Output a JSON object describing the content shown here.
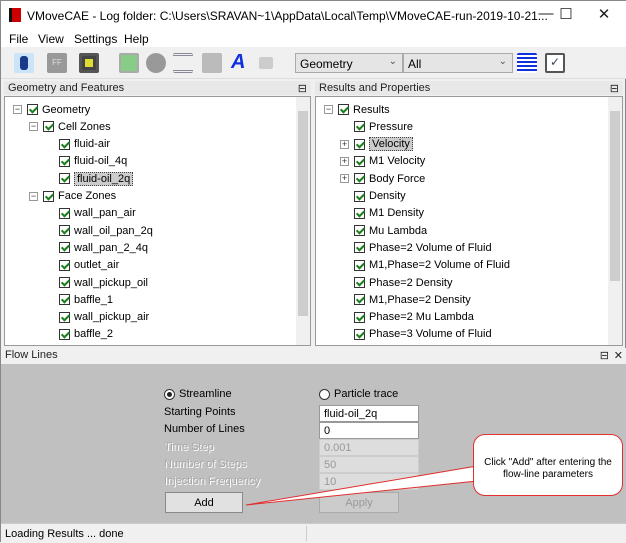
{
  "window": {
    "title": "VMoveCAE - Log folder: C:\\Users\\SRAVAN~1\\AppData\\Local\\Temp\\VMoveCAE-run-2019-10-21...",
    "minimize": "—",
    "maximize": "☐",
    "close": "✕"
  },
  "menu": [
    "File",
    "View",
    "Settings",
    "Help"
  ],
  "toolbar": {
    "icons": [
      "open-icon",
      "ff-icon",
      "save-icon",
      "cube-icon",
      "disc-icon",
      "streamlines-icon",
      "layers-add-icon",
      "text-icon",
      "stack-icon",
      "list-icon",
      "checkbox-icon"
    ],
    "text_glyph": "A",
    "ff_glyph": "FF",
    "dropdown1": "Geometry",
    "dropdown2": "All"
  },
  "left_panel": {
    "title": "Geometry and Features",
    "items": [
      {
        "label": "Geometry",
        "level": 0,
        "expand": "−"
      },
      {
        "label": "Cell Zones",
        "level": 1,
        "expand": "−"
      },
      {
        "label": "fluid-air",
        "level": 2
      },
      {
        "label": "fluid-oil_4q",
        "level": 2
      },
      {
        "label": "fluid-oil_2q",
        "level": 2,
        "selected": true
      },
      {
        "label": "Face Zones",
        "level": 1,
        "expand": "−"
      },
      {
        "label": "wall_pan_air",
        "level": 2
      },
      {
        "label": "wall_oil_pan_2q",
        "level": 2
      },
      {
        "label": "wall_pan_2_4q",
        "level": 2
      },
      {
        "label": "outlet_air",
        "level": 2
      },
      {
        "label": "wall_pickup_oil",
        "level": 2
      },
      {
        "label": "baffle_1",
        "level": 2
      },
      {
        "label": "wall_pickup_air",
        "level": 2
      },
      {
        "label": "baffle_2",
        "level": 2
      }
    ]
  },
  "right_panel": {
    "title": "Results and Properties",
    "items": [
      {
        "label": "Results",
        "level": 0,
        "expand": "−"
      },
      {
        "label": "Pressure",
        "level": 1
      },
      {
        "label": "Velocity",
        "level": 1,
        "expand": "+",
        "selected": true
      },
      {
        "label": "M1 Velocity",
        "level": 1,
        "expand": "+"
      },
      {
        "label": "Body Force",
        "level": 1,
        "expand": "+"
      },
      {
        "label": "Density",
        "level": 1
      },
      {
        "label": "M1 Density",
        "level": 1
      },
      {
        "label": "Mu Lambda",
        "level": 1
      },
      {
        "label": "Phase=2 Volume of Fluid",
        "level": 1
      },
      {
        "label": "M1,Phase=2 Volume of Fluid",
        "level": 1
      },
      {
        "label": "Phase=2 Density",
        "level": 1
      },
      {
        "label": "M1,Phase=2 Density",
        "level": 1
      },
      {
        "label": "Phase=2 Mu Lambda",
        "level": 1
      },
      {
        "label": "Phase=3 Volume of Fluid",
        "level": 1
      }
    ]
  },
  "flow_lines": {
    "title": "Flow Lines",
    "streamline": "Streamline",
    "particle_trace": "Particle trace",
    "mode": "Streamline",
    "starting_points_label": "Starting Points",
    "starting_points": "fluid-oil_2q",
    "num_lines_label": "Number of Lines",
    "num_lines": "0",
    "time_step_label": "Time Step",
    "time_step": "0.001",
    "num_steps_label": "Number of Steps",
    "num_steps": "50",
    "injection_label": "Injection Frequency",
    "injection": "10",
    "add": "Add",
    "apply": "Apply"
  },
  "callout": "Click \"Add\" after entering the flow-line parameters",
  "status": "Loading Results ... done"
}
